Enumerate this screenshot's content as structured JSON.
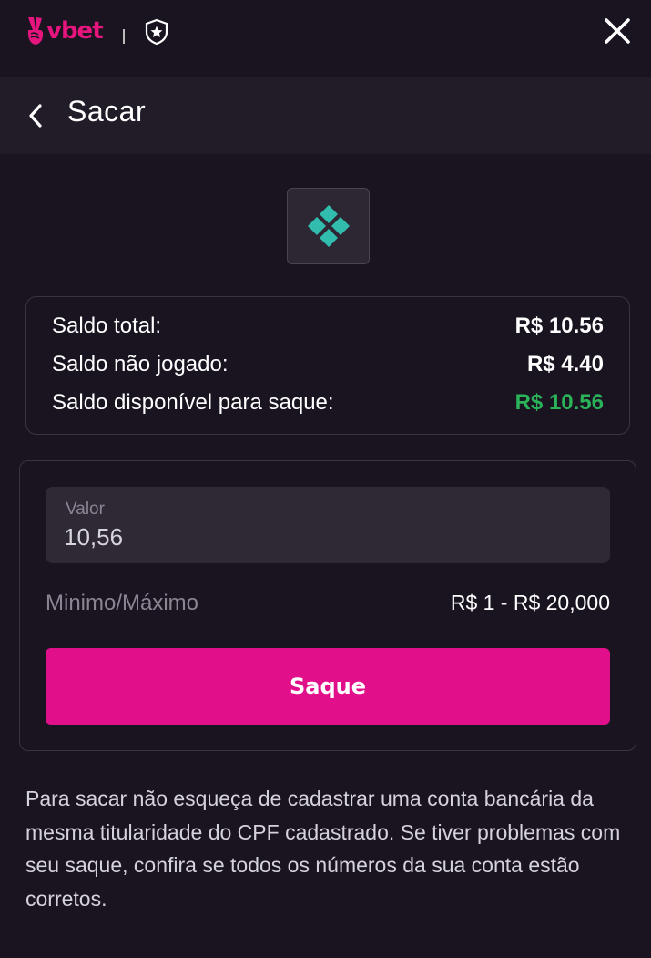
{
  "brand": {
    "name": "vbet",
    "color": "#e6157e"
  },
  "header": {
    "close_icon": "close-icon",
    "shield_icon": "shield-star-icon"
  },
  "subheader": {
    "title": "Sacar",
    "back_icon": "chevron-left-icon"
  },
  "payment_method": {
    "icon": "pix-icon",
    "color": "#32bcad"
  },
  "balances": {
    "total_label": "Saldo total:",
    "total_value": "R$ 10.56",
    "unplayed_label": "Saldo não jogado:",
    "unplayed_value": "R$ 4.40",
    "available_label": "Saldo disponível para saque:",
    "available_value": "R$ 10.56",
    "available_color": "#2bb35a"
  },
  "form": {
    "amount_label": "Valor",
    "amount_value": "10,56",
    "minmax_label": "Minimo/Máximo",
    "minmax_value": "R$ 1 - R$ 20,000",
    "submit_label": "Saque",
    "submit_color": "#e20f8a"
  },
  "notice": "Para sacar não esqueça de cadastrar uma conta bancária da mesma titularidade do CPF cadastrado. Se tiver problemas com seu saque, confira se todos os números da sua conta estão corretos."
}
